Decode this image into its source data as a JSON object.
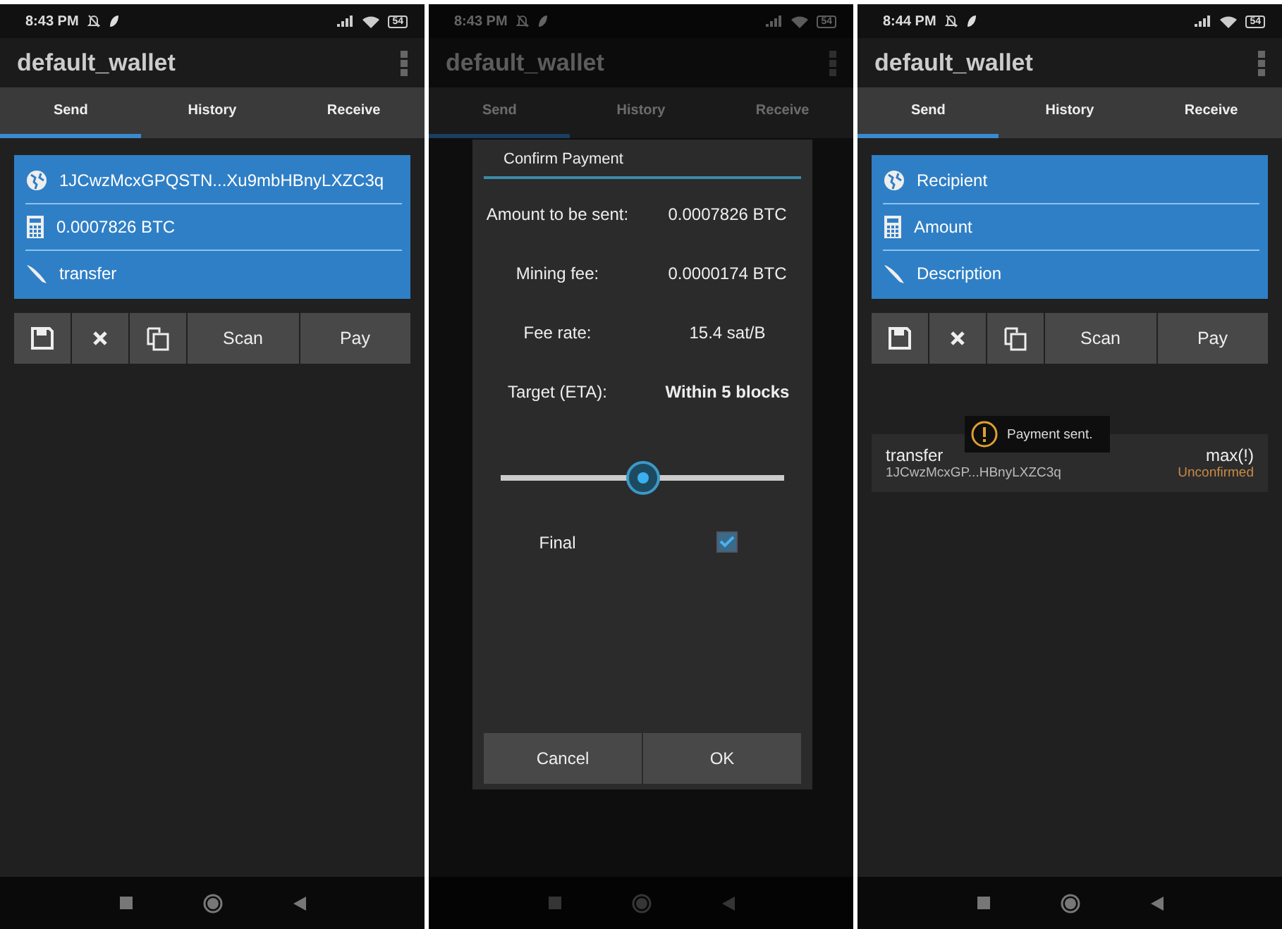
{
  "screens": [
    {
      "status": {
        "time": "8:43 PM",
        "battery": "54"
      },
      "title": "default_wallet",
      "tabs": [
        {
          "label": "Send",
          "selected": true
        },
        {
          "label": "History",
          "selected": false
        },
        {
          "label": "Receive",
          "selected": false
        }
      ],
      "form": {
        "fields": [
          {
            "kind": "address",
            "value": "1JCwzMcxGPQSTN...Xu9mbHBnyLXZC3q"
          },
          {
            "kind": "amount",
            "value": "0.0007826 BTC"
          },
          {
            "kind": "description",
            "value": "transfer"
          }
        ]
      },
      "actions": [
        {
          "kind": "save"
        },
        {
          "kind": "clear"
        },
        {
          "kind": "copy"
        },
        {
          "kind": "text",
          "label": "Scan"
        },
        {
          "kind": "text",
          "label": "Pay"
        }
      ]
    },
    {
      "status": {
        "time": "8:43 PM",
        "battery": "54"
      },
      "title": "default_wallet",
      "dimmed": true,
      "tabs": [
        {
          "label": "Send",
          "selected": true
        },
        {
          "label": "History",
          "selected": false
        },
        {
          "label": "Receive",
          "selected": false
        }
      ],
      "dialog": {
        "title": "Confirm Payment",
        "rows": [
          {
            "label": "Amount to be sent:",
            "value": "0.0007826 BTC",
            "bold": false
          },
          {
            "label": "Mining fee:",
            "value": "0.0000174 BTC",
            "bold": false
          },
          {
            "label": "Fee rate:",
            "value": "15.4 sat/B",
            "bold": false
          },
          {
            "label": "Target (ETA):",
            "value": "Within 5 blocks",
            "bold": true
          }
        ],
        "slider": {
          "level": 0.5
        },
        "final": {
          "label": "Final",
          "checked": true
        },
        "buttons": [
          "Cancel",
          "OK"
        ]
      }
    },
    {
      "status": {
        "time": "8:44 PM",
        "battery": "54"
      },
      "title": "default_wallet",
      "tabs": [
        {
          "label": "Send",
          "selected": true
        },
        {
          "label": "History",
          "selected": false
        },
        {
          "label": "Receive",
          "selected": false
        }
      ],
      "form": {
        "fields": [
          {
            "kind": "address",
            "placeholder": "Recipient"
          },
          {
            "kind": "amount",
            "placeholder": "Amount"
          },
          {
            "kind": "description",
            "placeholder": "Description"
          }
        ]
      },
      "actions": [
        {
          "kind": "save"
        },
        {
          "kind": "clear"
        },
        {
          "kind": "copy"
        },
        {
          "kind": "text",
          "label": "Scan"
        },
        {
          "kind": "text",
          "label": "Pay"
        }
      ],
      "transactions": [
        {
          "title": "transfer",
          "address": "1JCwzMcxGP...HBnyLXZC3q",
          "amount": "max(!)",
          "status": "Unconfirmed",
          "color": "#c98a45"
        }
      ],
      "toast": {
        "text": "Payment sent."
      }
    }
  ]
}
